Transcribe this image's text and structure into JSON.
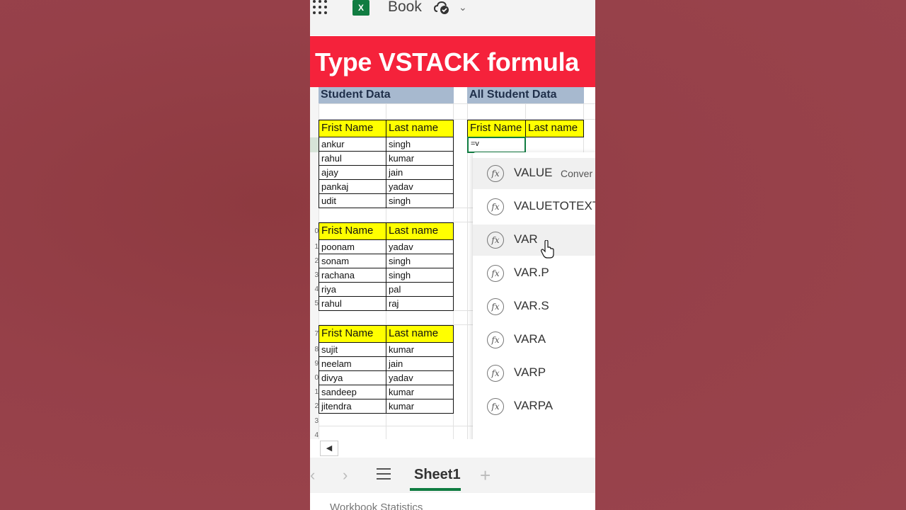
{
  "app": {
    "title": "Book",
    "icon": "excel-logo"
  },
  "banner": {
    "text": "Type  VSTACK formula",
    "color": "#f5223b"
  },
  "sheet": {
    "left_title": "Student Data",
    "right_title": "All Student Data",
    "header": {
      "first": "Frist Name",
      "last": "Last name"
    },
    "tables": [
      {
        "rows": [
          [
            "ankur",
            "singh"
          ],
          [
            "rahul",
            "kumar"
          ],
          [
            "ajay",
            "jain"
          ],
          [
            "pankaj",
            "yadav"
          ],
          [
            "udit",
            "singh"
          ]
        ]
      },
      {
        "rows": [
          [
            "poonam",
            "yadav"
          ],
          [
            "sonam",
            "singh"
          ],
          [
            "rachana",
            "singh"
          ],
          [
            "riya",
            "pal"
          ],
          [
            "rahul",
            "raj"
          ]
        ]
      },
      {
        "rows": [
          [
            "sujit",
            "kumar"
          ],
          [
            "neelam",
            "jain"
          ],
          [
            "divya",
            "yadav"
          ],
          [
            "sandeep",
            "kumar"
          ],
          [
            "jitendra",
            "kumar"
          ]
        ]
      }
    ],
    "active_cell_input": "=v",
    "row_numbers": [
      "0",
      "1",
      "2",
      "3",
      "4",
      "5",
      "7",
      "8",
      "9",
      "0",
      "1",
      "2",
      "3",
      "4"
    ]
  },
  "suggestions": [
    {
      "name": "VALUE",
      "desc": "Conver",
      "highlighted": true
    },
    {
      "name": "VALUETOTEXT",
      "desc": ""
    },
    {
      "name": "VAR",
      "desc": "",
      "hovered": true
    },
    {
      "name": "VAR.P",
      "desc": ""
    },
    {
      "name": "VAR.S",
      "desc": ""
    },
    {
      "name": "VARA",
      "desc": ""
    },
    {
      "name": "VARP",
      "desc": ""
    },
    {
      "name": "VARPA",
      "desc": ""
    }
  ],
  "tabs": {
    "active": "Sheet1"
  },
  "status": {
    "text": "Workbook Statistics"
  },
  "colors": {
    "header_fill": "#ffff00",
    "title_fill": "#a7b9cf",
    "excel_green": "#107c41",
    "background": "#964049"
  }
}
